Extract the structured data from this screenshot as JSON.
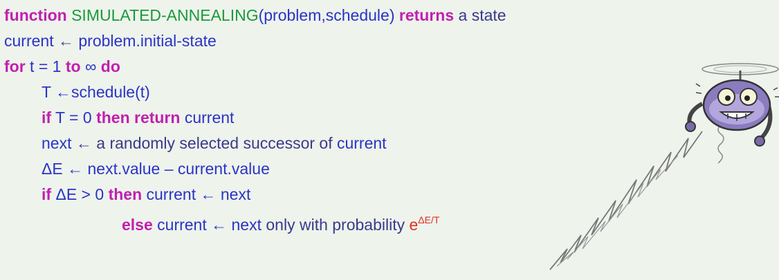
{
  "lines": [
    {
      "indent": 0,
      "tokens": [
        {
          "t": "function",
          "c": "kw"
        },
        {
          "t": " ",
          "c": "txt"
        },
        {
          "t": "SIMULATED-ANNEALING",
          "c": "fn"
        },
        {
          "t": "(problem,schedule) ",
          "c": "var"
        },
        {
          "t": "returns",
          "c": "kw"
        },
        {
          "t": " a  state",
          "c": "txt"
        }
      ]
    },
    {
      "indent": 0,
      "tokens": [
        {
          "t": "current",
          "c": "var"
        },
        {
          "t": " ← ",
          "c": "txt"
        },
        {
          "t": "problem.initial-state",
          "c": "var"
        }
      ]
    },
    {
      "indent": 0,
      "tokens": [
        {
          "t": "for",
          "c": "kw"
        },
        {
          "t": " t = 1 ",
          "c": "var"
        },
        {
          "t": "to",
          "c": "kw"
        },
        {
          "t": " ∞ ",
          "c": "var"
        },
        {
          "t": "do",
          "c": "kw"
        }
      ]
    },
    {
      "indent": 1,
      "tokens": [
        {
          "t": "T ←schedule(t)",
          "c": "var"
        }
      ]
    },
    {
      "indent": 1,
      "tokens": [
        {
          "t": "if",
          "c": "kw"
        },
        {
          "t": " T = 0 ",
          "c": "var"
        },
        {
          "t": "then return",
          "c": "kw"
        },
        {
          "t": " current",
          "c": "var"
        }
      ]
    },
    {
      "indent": 1,
      "tokens": [
        {
          "t": "next",
          "c": "var"
        },
        {
          "t": " ← a randomly selected successor of ",
          "c": "txt"
        },
        {
          "t": "current",
          "c": "var"
        }
      ]
    },
    {
      "indent": 1,
      "tokens": [
        {
          "t": "ΔE ← next.value – current.value",
          "c": "var"
        }
      ]
    },
    {
      "indent": 1,
      "tokens": [
        {
          "t": "if",
          "c": "kw"
        },
        {
          "t": " ΔE > 0 ",
          "c": "var"
        },
        {
          "t": "then",
          "c": "kw"
        },
        {
          "t": " current ← next",
          "c": "var"
        }
      ]
    },
    {
      "indent": 2,
      "tokens": [
        {
          "t": "else",
          "c": "kw"
        },
        {
          "t": " current ← next",
          "c": "var"
        },
        {
          "t": " only with probability ",
          "c": "txt"
        },
        {
          "t": "e",
          "c": "exp"
        },
        {
          "t": "ΔE/T",
          "c": "sup"
        }
      ]
    }
  ],
  "illustration": {
    "icon": "propeller-robot-icon"
  }
}
